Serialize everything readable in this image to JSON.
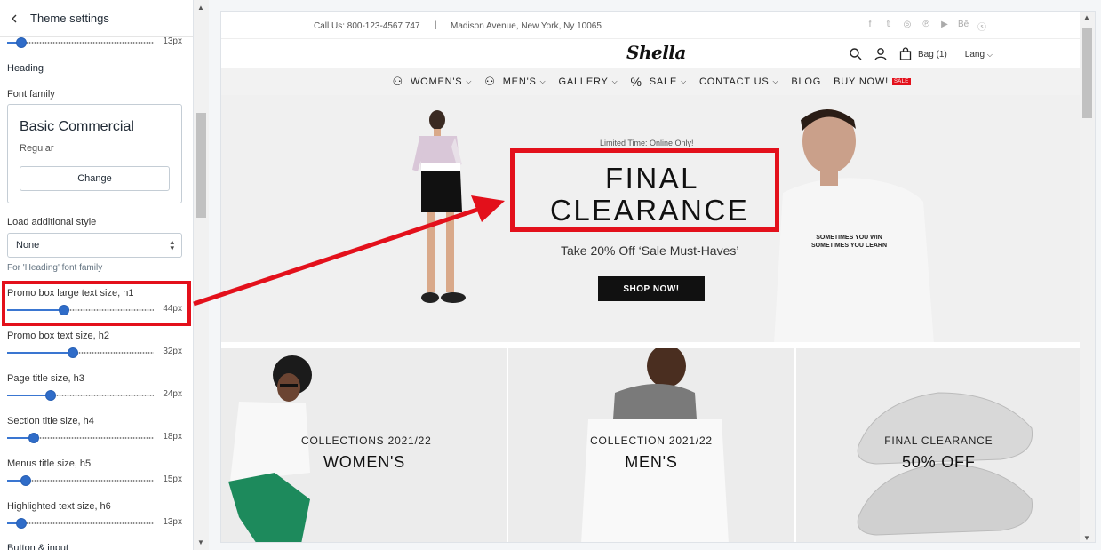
{
  "sidebar": {
    "title": "Theme settings",
    "top_slider_value": "13px",
    "heading_section": "Heading",
    "font_family_label": "Font family",
    "font_name": "Basic Commercial",
    "font_style": "Regular",
    "change_label": "Change",
    "load_style_label": "Load additional style",
    "load_style_value": "None",
    "load_style_hint": "For 'Heading' font family",
    "sliders": [
      {
        "label": "Promo box large text size, h1",
        "value": "44px",
        "level": 0.27
      },
      {
        "label": "Promo box text size, h2",
        "value": "32px",
        "level": 0.45
      },
      {
        "label": "Page title size, h3",
        "value": "24px",
        "level": 0.31
      },
      {
        "label": "Section title size, h4",
        "value": "18px",
        "level": 0.19
      },
      {
        "label": "Menus title size, h5",
        "value": "15px",
        "level": 0.13
      },
      {
        "label": "Highlighted text size, h6",
        "value": "13px",
        "level": 0.09
      }
    ],
    "next_section": "Button & input"
  },
  "store": {
    "contact": "Call Us: 800-123-4567 747",
    "separator": "|",
    "address": "Madison Avenue, New York, Ny 10065",
    "socials": [
      "f",
      "𝕥",
      "◎",
      "℗",
      "▶",
      "Bē",
      "ⓢ"
    ],
    "logo": "Shella",
    "bag_label": "Bag (1)",
    "lang_label": "Lang",
    "nav": [
      {
        "label": "WOMEN'S",
        "chevron": true
      },
      {
        "label": "MEN'S",
        "chevron": true
      },
      {
        "label": "GALLERY",
        "chevron": true
      },
      {
        "label": "SALE",
        "chevron": true
      },
      {
        "label": "CONTACT US",
        "chevron": true
      },
      {
        "label": "BLOG",
        "chevron": false
      },
      {
        "label": "BUY NOW!",
        "chevron": false
      }
    ],
    "sale_badge": "SALE",
    "hero": {
      "limited": "Limited Time: Online Only!",
      "line1": "FINAL",
      "line2": "CLEARANCE",
      "offer": "Take 20% Off ‘Sale Must-Haves’",
      "button": "SHOP NOW!",
      "shirt_text": "SOMETIMES YOU WIN\nSOMETIMES YOU LEARN"
    },
    "cards": [
      {
        "title": "COLLECTIONS 2021/22",
        "subtitle": "WOMEN'S"
      },
      {
        "title": "COLLECTION 2021/22",
        "subtitle": "MEN'S"
      },
      {
        "title": "FINAL CLEARANCE",
        "subtitle": "50% OFF"
      }
    ]
  },
  "colors": {
    "highlight": "#e3101b",
    "slider": "#2f6cc8",
    "button_dark": "#111111"
  }
}
